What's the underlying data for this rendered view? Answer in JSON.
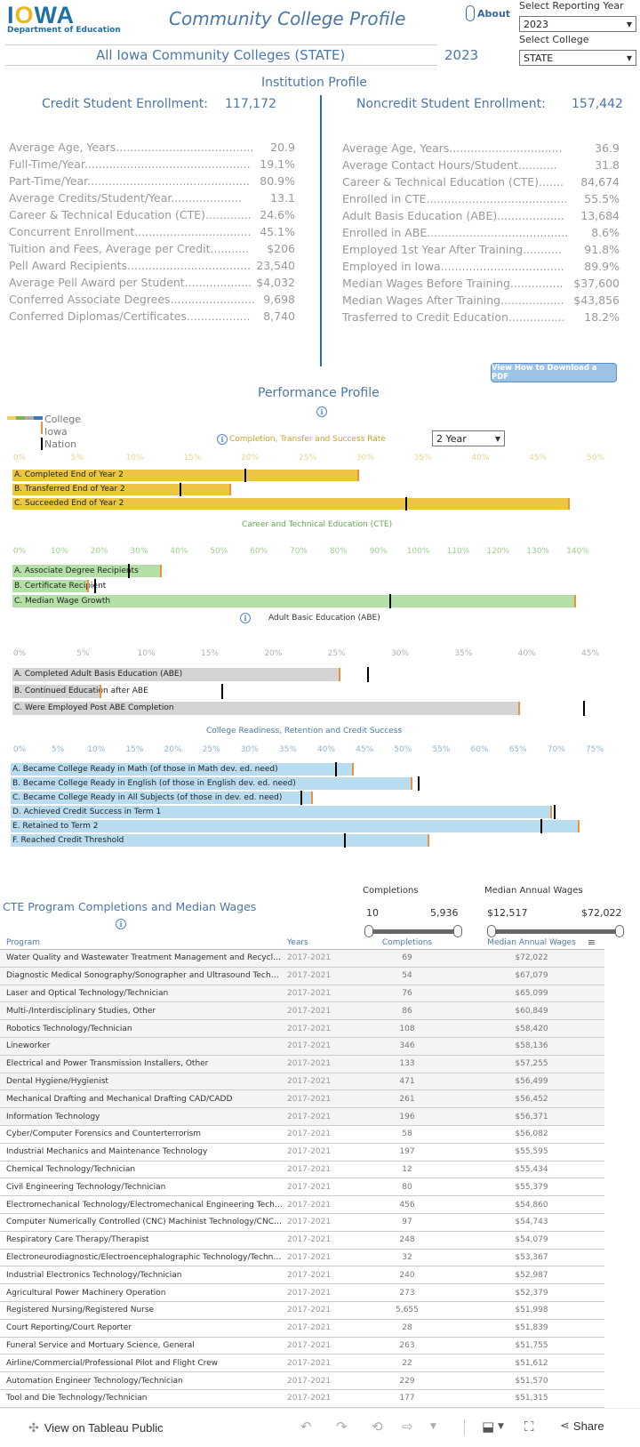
{
  "header": {
    "logo_text": "IOWA",
    "logo_subtitle": "Department of Education",
    "title": "Community College Profile",
    "about_label": "About",
    "college_name": "All Iowa Community Colleges (STATE)",
    "year_display": "2023"
  },
  "filters": {
    "year_label": "Select Reporting Year",
    "year_value": "2023",
    "college_label": "Select College",
    "college_value": "STATE"
  },
  "institution": {
    "title": "Institution Profile",
    "credit": {
      "label": "Credit Student Enrollment:",
      "value": "117,172",
      "stats": [
        {
          "label": "Average Age, Years.......................................",
          "value": "20.9"
        },
        {
          "label": "Full-Time/Year...............................................",
          "value": "19.1%"
        },
        {
          "label": "Part-Time/Year..............................................",
          "value": "80.9%"
        },
        {
          "label": "Average Credits/Student/Year....................",
          "value": "13.1"
        },
        {
          "label": "Career & Technical Education (CTE).............",
          "value": "24.6%"
        },
        {
          "label": "Concurrent Enrollment.................................",
          "value": "45.1%"
        },
        {
          "label": "Tuition and Fees, Average per Credit...........",
          "value": "$206"
        },
        {
          "label": "Pell Award Recipients...................................",
          "value": "23,540"
        },
        {
          "label": "Average Pell Award per Student...................",
          "value": "$4,032"
        },
        {
          "label": "Conferred Associate Degrees........................",
          "value": "9,698"
        },
        {
          "label": "Conferred Diplomas/Certificates..................",
          "value": "8,740"
        }
      ]
    },
    "noncredit": {
      "label": "Noncredit Student Enrollment:",
      "value": "157,442",
      "stats": [
        {
          "label": "Average Age, Years................................",
          "value": "36.9"
        },
        {
          "label": "Average Contact Hours/Student...........",
          "value": "31.8"
        },
        {
          "label": "Career & Technical Education (CTE).......",
          "value": "84,674"
        },
        {
          "label": "Enrolled in CTE........................................",
          "value": "55.5%"
        },
        {
          "label": "Adult Basis Education (ABE)...................",
          "value": "13,684"
        },
        {
          "label": "Enrolled in ABE........................................",
          "value": "8.6%"
        },
        {
          "label": "Employed 1st Year After Training...........",
          "value": "91.8%"
        },
        {
          "label": "Employed in Iowa...................................",
          "value": "89.9%"
        },
        {
          "label": "Median Wages Before Training...............",
          "value": "$37,600"
        },
        {
          "label": "Median Wages After Training..................",
          "value": "$43,856"
        },
        {
          "label": "Trasferred to Credit Education................",
          "value": "18.2%"
        }
      ]
    }
  },
  "pdf_button": "View How to Download a PDF",
  "performance": {
    "title": "Performance Profile",
    "legend": {
      "college": "College",
      "iowa": "Iowa",
      "nation": "Nation",
      "college_colors": [
        "#f0d060",
        "#7ab648",
        "#aaaaaa",
        "#3a78b8"
      ],
      "iowa_color": "#f0913a",
      "nation_color": "#000000"
    },
    "period_select": "2 Year"
  },
  "chart_data": [
    {
      "type": "bar",
      "title": "Completion, Transfer and Success Rate",
      "color": "#ebc644",
      "tick_color": "#e8d48a",
      "title_color": "#c9a227",
      "xlim": [
        0,
        50
      ],
      "ticks": [
        "0%",
        "5%",
        "10%",
        "15%",
        "20%",
        "25%",
        "30%",
        "35%",
        "40%",
        "45%",
        "50%"
      ],
      "tick_values": [
        0,
        5,
        10,
        15,
        20,
        25,
        30,
        35,
        40,
        45,
        50
      ],
      "categories": [
        "A. Completed End of Year 2",
        "B. Transferred End of Year 2",
        "C. Succeeded End of Year 2"
      ],
      "series": [
        {
          "name": "College",
          "values": [
            29.4,
            18.3,
            47.7
          ]
        },
        {
          "name": "Iowa",
          "values": [
            29.4,
            18.3,
            47.7
          ]
        },
        {
          "name": "Nation",
          "values": [
            19.6,
            14.0,
            33.6
          ]
        }
      ]
    },
    {
      "type": "bar",
      "title": "Career and Technical Education (CTE)",
      "color": "#b3e0a6",
      "tick_color": "#9ccf8e",
      "title_color": "#5fa84f",
      "xlim": [
        0,
        145
      ],
      "ticks": [
        "0%",
        "10%",
        "20%",
        "30%",
        "40%",
        "50%",
        "60%",
        "70%",
        "80%",
        "90%",
        "100%",
        "110%",
        "120%",
        "130%",
        "140%"
      ],
      "tick_values": [
        0,
        10,
        20,
        30,
        40,
        50,
        60,
        70,
        80,
        90,
        100,
        110,
        120,
        130,
        140
      ],
      "categories": [
        "A. Associate Degree Recipients",
        "B. Certificate Recipient",
        "C. Median Wage Growth"
      ],
      "series": [
        {
          "name": "College",
          "values": [
            35.5,
            17.2,
            139.3
          ]
        },
        {
          "name": "Iowa",
          "values": [
            35.5,
            17.2,
            139.3
          ]
        },
        {
          "name": "Nation",
          "values": [
            27.5,
            19.0,
            93.0
          ]
        }
      ]
    },
    {
      "type": "bar",
      "title": "Adult Basic Education (ABE)",
      "color": "#d4d4d4",
      "tick_color": "#b0b0b0",
      "title_color": "#333333",
      "xlim": [
        0,
        46
      ],
      "ticks": [
        "0%",
        "5%",
        "10%",
        "15%",
        "20%",
        "25%",
        "30%",
        "35%",
        "40%",
        "45%"
      ],
      "tick_values": [
        0,
        5,
        10,
        15,
        20,
        25,
        30,
        35,
        40,
        45
      ],
      "categories": [
        "A. Completed Adult Basis Education (ABE)",
        "B. Continued Education after ABE",
        "C. Were Employed Post ABE Completion"
      ],
      "series": [
        {
          "name": "College",
          "values": [
            25.2,
            6.4,
            39.4
          ]
        },
        {
          "name": "Iowa",
          "values": [
            25.2,
            6.4,
            39.4
          ]
        },
        {
          "name": "Nation",
          "values": [
            27.5,
            16.0,
            44.5
          ]
        }
      ]
    },
    {
      "type": "bar",
      "title": "College Readiness, Retention and Credit Success",
      "color": "#b9ddf0",
      "tick_color": "#8fb4d6",
      "title_color": "#4a77a8",
      "xlim": [
        0,
        76
      ],
      "ticks": [
        "0%",
        "5%",
        "10%",
        "15%",
        "20%",
        "25%",
        "30%",
        "35%",
        "40%",
        "45%",
        "50%",
        "55%",
        "60%",
        "65%",
        "70%",
        "75%"
      ],
      "tick_values": [
        0,
        5,
        10,
        15,
        20,
        25,
        30,
        35,
        40,
        45,
        50,
        55,
        60,
        65,
        70,
        75
      ],
      "categories": [
        "A. Became College Ready in Math (of those in Math dev. ed. need)",
        "B. Became College Ready in English (of those in English dev. ed. need)",
        "C. Became College Ready in All Subjects (of those in dev. ed. need)",
        "D. Achieved Credit Success in Term 1",
        "E. Retained to Term 2",
        "F. Reached Credit Threshold"
      ],
      "series": [
        {
          "name": "College",
          "values": [
            43.7,
            51.3,
            38.4,
            69.5,
            73.2,
            53.6
          ]
        },
        {
          "name": "Iowa",
          "values": [
            43.7,
            51.3,
            38.4,
            69.5,
            73.2,
            53.6
          ]
        },
        {
          "name": "Nation",
          "values": [
            41.5,
            52.3,
            37.0,
            70.0,
            68.3,
            42.7
          ]
        }
      ]
    }
  ],
  "cte_programs": {
    "title": "CTE Program Completions and Median Wages",
    "completions_filter": {
      "label": "Completions",
      "min": "10",
      "max": "5,936"
    },
    "wages_filter": {
      "label": "Median Annual Wages",
      "min": "$12,517",
      "max": "$72,022"
    },
    "columns": [
      "Program",
      "Years",
      "Completions",
      "Median Annual Wages"
    ],
    "rows": [
      {
        "program": "Water Quality and Wastewater Treatment Management and Recycling T..",
        "years": "2017-2021",
        "completions": "69",
        "wage": "$72,022"
      },
      {
        "program": "Diagnostic Medical Sonography/Sonographer and Ultrasound Technician",
        "years": "2017-2021",
        "completions": "54",
        "wage": "$67,079"
      },
      {
        "program": "Laser and Optical Technology/Technician",
        "years": "2017-2021",
        "completions": "76",
        "wage": "$65,099"
      },
      {
        "program": "Multi-/Interdisciplinary Studies, Other",
        "years": "2017-2021",
        "completions": "86",
        "wage": "$60,849"
      },
      {
        "program": "Robotics Technology/Technician",
        "years": "2017-2021",
        "completions": "108",
        "wage": "$58,420"
      },
      {
        "program": "Lineworker",
        "years": "2017-2021",
        "completions": "346",
        "wage": "$58,136"
      },
      {
        "program": "Electrical and Power Transmission Installers, Other",
        "years": "2017-2021",
        "completions": "133",
        "wage": "$57,255"
      },
      {
        "program": "Dental Hygiene/Hygienist",
        "years": "2017-2021",
        "completions": "471",
        "wage": "$56,499"
      },
      {
        "program": "Mechanical Drafting and Mechanical Drafting CAD/CADD",
        "years": "2017-2021",
        "completions": "261",
        "wage": "$56,452"
      },
      {
        "program": "Information Technology",
        "years": "2017-2021",
        "completions": "196",
        "wage": "$56,371"
      },
      {
        "program": "Cyber/Computer Forensics and Counterterrorism",
        "years": "2017-2021",
        "completions": "58",
        "wage": "$56,082"
      },
      {
        "program": "Industrial Mechanics and Maintenance Technology",
        "years": "2017-2021",
        "completions": "197",
        "wage": "$55,595"
      },
      {
        "program": "Chemical Technology/Technician",
        "years": "2017-2021",
        "completions": "12",
        "wage": "$55,434"
      },
      {
        "program": "Civil Engineering Technology/Technician",
        "years": "2017-2021",
        "completions": "80",
        "wage": "$55,379"
      },
      {
        "program": "Electromechanical Technology/Electromechanical Engineering Technology",
        "years": "2017-2021",
        "completions": "456",
        "wage": "$54,860"
      },
      {
        "program": "Computer Numerically Controlled (CNC) Machinist Technology/CNC Mach..",
        "years": "2017-2021",
        "completions": "97",
        "wage": "$54,743"
      },
      {
        "program": "Respiratory Care Therapy/Therapist",
        "years": "2017-2021",
        "completions": "248",
        "wage": "$54,079"
      },
      {
        "program": "Electroneurodiagnostic/Electroencephalographic Technology/Technologi..",
        "years": "2017-2021",
        "completions": "32",
        "wage": "$53,367"
      },
      {
        "program": "Industrial Electronics Technology/Technician",
        "years": "2017-2021",
        "completions": "240",
        "wage": "$52,987"
      },
      {
        "program": "Agricultural Power Machinery Operation",
        "years": "2017-2021",
        "completions": "273",
        "wage": "$52,379"
      },
      {
        "program": "Registered Nursing/Registered Nurse",
        "years": "2017-2021",
        "completions": "5,655",
        "wage": "$51,998"
      },
      {
        "program": "Court Reporting/Court Reporter",
        "years": "2017-2021",
        "completions": "28",
        "wage": "$51,839"
      },
      {
        "program": "Funeral Service and Mortuary Science, General",
        "years": "2017-2021",
        "completions": "263",
        "wage": "$51,755"
      },
      {
        "program": "Airline/Commercial/Professional Pilot and Flight Crew",
        "years": "2017-2021",
        "completions": "22",
        "wage": "$51,612"
      },
      {
        "program": "Automation Engineer Technology/Technician",
        "years": "2017-2021",
        "completions": "229",
        "wage": "$51,570"
      },
      {
        "program": "Tool and Die Technology/Technician",
        "years": "2017-2021",
        "completions": "177",
        "wage": "$51,315"
      }
    ]
  },
  "footer": {
    "tableau_link": "View on Tableau Public",
    "share_label": "Share"
  }
}
